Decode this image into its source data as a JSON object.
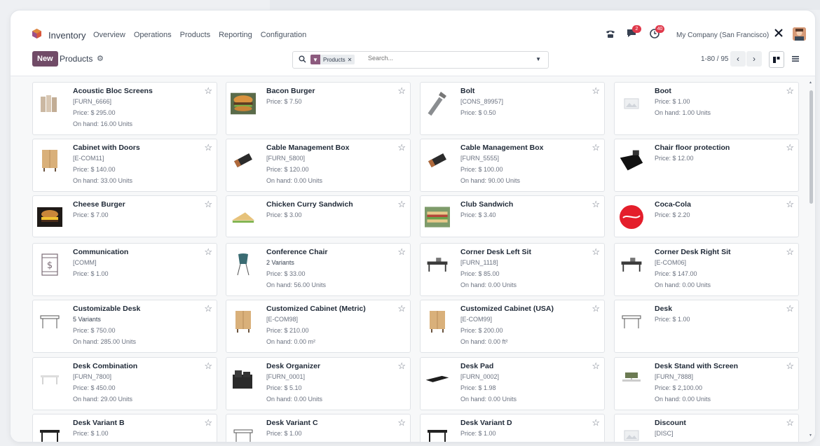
{
  "nav": {
    "app_name": "Inventory",
    "menu": [
      "Overview",
      "Operations",
      "Products",
      "Reporting",
      "Configuration"
    ],
    "chat_badge": "2",
    "activity_badge": "40",
    "company": "My Company (San Francisco)"
  },
  "control": {
    "new_label": "New",
    "breadcrumb": "Products",
    "search": {
      "facet_label": "Products",
      "placeholder": "Search..."
    },
    "pager": "1-80 / 95"
  },
  "products": [
    {
      "name": "Acoustic Bloc Screens",
      "lines": [
        "[FURN_6666]",
        "Price: $ 295.00",
        "On hand: 16.00 Units"
      ],
      "icon": "acoustic-screen"
    },
    {
      "name": "Bacon Burger",
      "lines": [
        "Price: $ 7.50"
      ],
      "icon": "burger"
    },
    {
      "name": "Bolt",
      "lines": [
        "[CONS_89957]",
        "Price: $ 0.50"
      ],
      "icon": "bolt"
    },
    {
      "name": "Boot",
      "lines": [
        "Price: $ 1.00",
        "On hand: 1.00 Units"
      ],
      "icon": "placeholder"
    },
    {
      "name": "Cabinet with Doors",
      "lines": [
        "[E-COM11]",
        "Price: $ 140.00",
        "On hand: 33.00 Units"
      ],
      "icon": "cabinet"
    },
    {
      "name": "Cable Management Box",
      "lines": [
        "[FURN_5800]",
        "Price: $ 120.00",
        "On hand: 0.00 Units"
      ],
      "icon": "cable-box"
    },
    {
      "name": "Cable Management Box",
      "lines": [
        "[FURN_5555]",
        "Price: $ 100.00",
        "On hand: 90.00 Units"
      ],
      "icon": "cable-box"
    },
    {
      "name": "Chair floor protection",
      "lines": [
        "Price: $ 12.00"
      ],
      "icon": "floor-mat"
    },
    {
      "name": "Cheese Burger",
      "lines": [
        "Price: $ 7.00"
      ],
      "icon": "cheese-burger"
    },
    {
      "name": "Chicken Curry Sandwich",
      "lines": [
        "Price: $ 3.00"
      ],
      "icon": "sandwich"
    },
    {
      "name": "Club Sandwich",
      "lines": [
        "Price: $ 3.40"
      ],
      "icon": "club-sandwich"
    },
    {
      "name": "Coca-Cola",
      "lines": [
        "Price: $ 2.20"
      ],
      "icon": "coca-cola"
    },
    {
      "name": "Communication",
      "lines": [
        "[COMM]",
        "Price: $ 1.00"
      ],
      "icon": "dollar-doc"
    },
    {
      "name": "Conference Chair",
      "lines": [
        "2 Variants",
        "Price: $ 33.00",
        "On hand: 56.00 Units"
      ],
      "icon": "chair"
    },
    {
      "name": "Corner Desk Left Sit",
      "lines": [
        "[FURN_1118]",
        "Price: $ 85.00",
        "On hand: 0.00 Units"
      ],
      "icon": "corner-desk"
    },
    {
      "name": "Corner Desk Right Sit",
      "lines": [
        "[E-COM06]",
        "Price: $ 147.00",
        "On hand: 0.00 Units"
      ],
      "icon": "corner-desk"
    },
    {
      "name": "Customizable Desk",
      "lines": [
        "5 Variants",
        "Price: $ 750.00",
        "On hand: 285.00 Units"
      ],
      "icon": "desk"
    },
    {
      "name": "Customized Cabinet (Metric)",
      "lines": [
        "[E-COM98]",
        "Price: $ 210.00",
        "On hand: 0.00 m²"
      ],
      "icon": "cabinet"
    },
    {
      "name": "Customized Cabinet (USA)",
      "lines": [
        "[E-COM99]",
        "Price: $ 200.00",
        "On hand: 0.00 ft²"
      ],
      "icon": "cabinet"
    },
    {
      "name": "Desk",
      "lines": [
        "Price: $ 1.00"
      ],
      "icon": "desk"
    },
    {
      "name": "Desk Combination",
      "lines": [
        "[FURN_7800]",
        "Price: $ 450.00",
        "On hand: 29.00 Units"
      ],
      "icon": "desk-combo"
    },
    {
      "name": "Desk Organizer",
      "lines": [
        "[FURN_0001]",
        "Price: $ 5.10",
        "On hand: 0.00 Units"
      ],
      "icon": "organizer"
    },
    {
      "name": "Desk Pad",
      "lines": [
        "[FURN_0002]",
        "Price: $ 1.98",
        "On hand: 0.00 Units"
      ],
      "icon": "desk-pad"
    },
    {
      "name": "Desk Stand with Screen",
      "lines": [
        "[FURN_7888]",
        "Price: $ 2,100.00",
        "On hand: 0.00 Units"
      ],
      "icon": "desk-stand"
    },
    {
      "name": "Desk Variant B",
      "lines": [
        "Price: $ 1.00"
      ],
      "icon": "desk-dark"
    },
    {
      "name": "Desk Variant C",
      "lines": [
        "Price: $ 1.00"
      ],
      "icon": "desk"
    },
    {
      "name": "Desk Variant D",
      "lines": [
        "Price: $ 1.00"
      ],
      "icon": "desk-dark"
    },
    {
      "name": "Discount",
      "lines": [
        "[DISC]"
      ],
      "icon": "placeholder"
    }
  ]
}
